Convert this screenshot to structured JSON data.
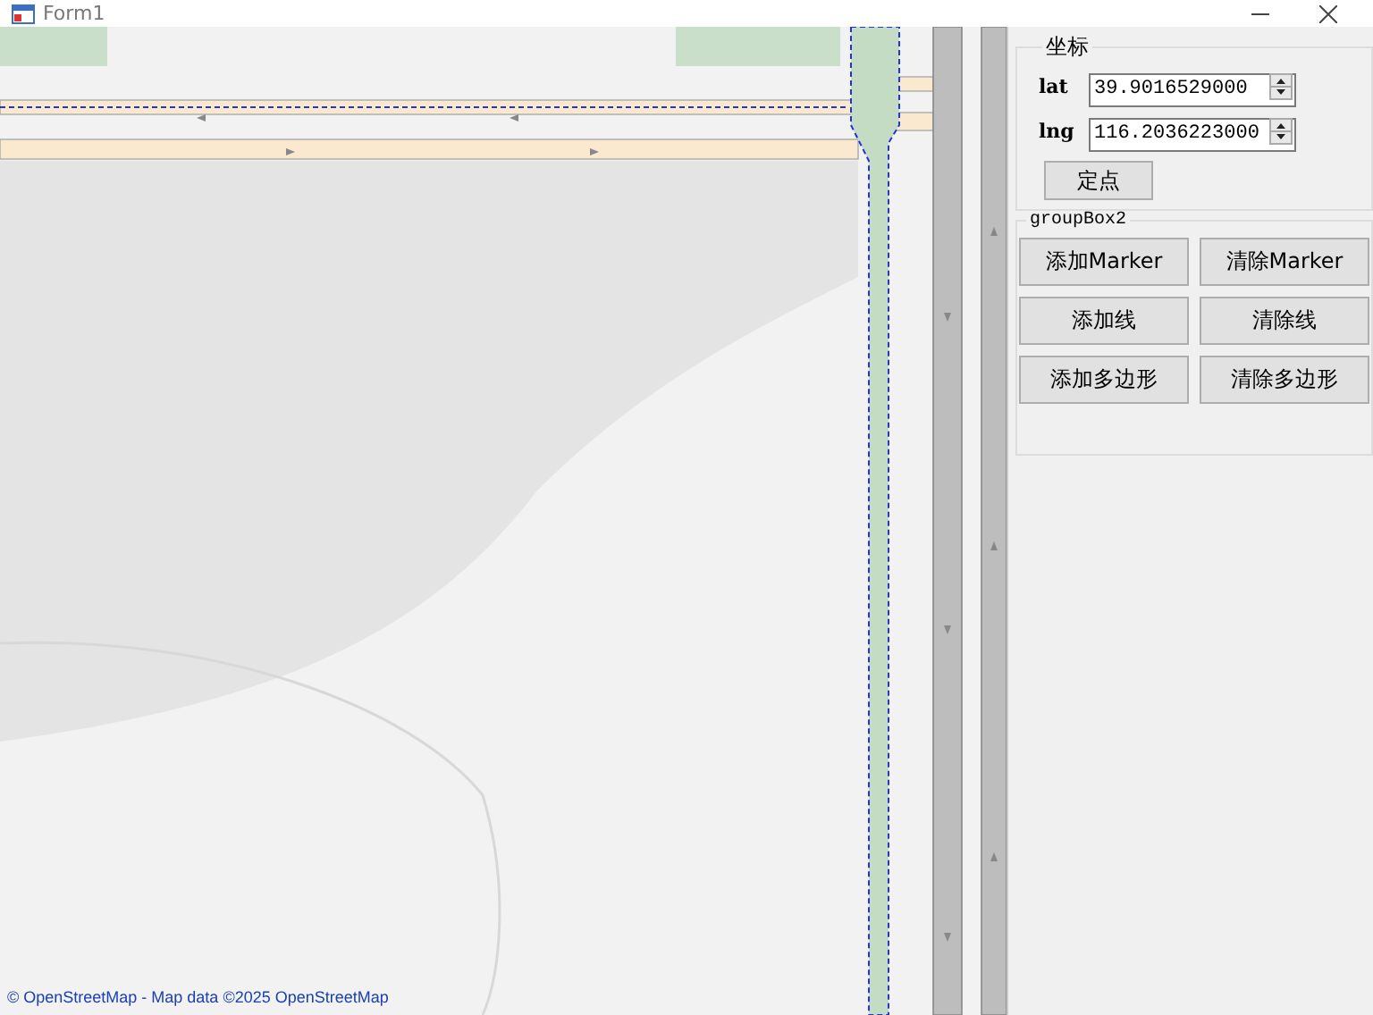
{
  "window": {
    "title": "Form1"
  },
  "map": {
    "attribution": "© OpenStreetMap - Map data ©2025 OpenStreetMap"
  },
  "coordinates_group": {
    "title": "坐标",
    "fields": [
      {
        "label": "lat",
        "value": "39.9016529000"
      },
      {
        "label": "lng",
        "value": "116.2036223000"
      }
    ],
    "locate_button": "定点"
  },
  "group_box_2": {
    "title": "groupBox2",
    "buttons": [
      "添加Marker",
      "清除Marker",
      "添加线",
      "清除线",
      "添加多边形",
      "清除多边形"
    ]
  }
}
